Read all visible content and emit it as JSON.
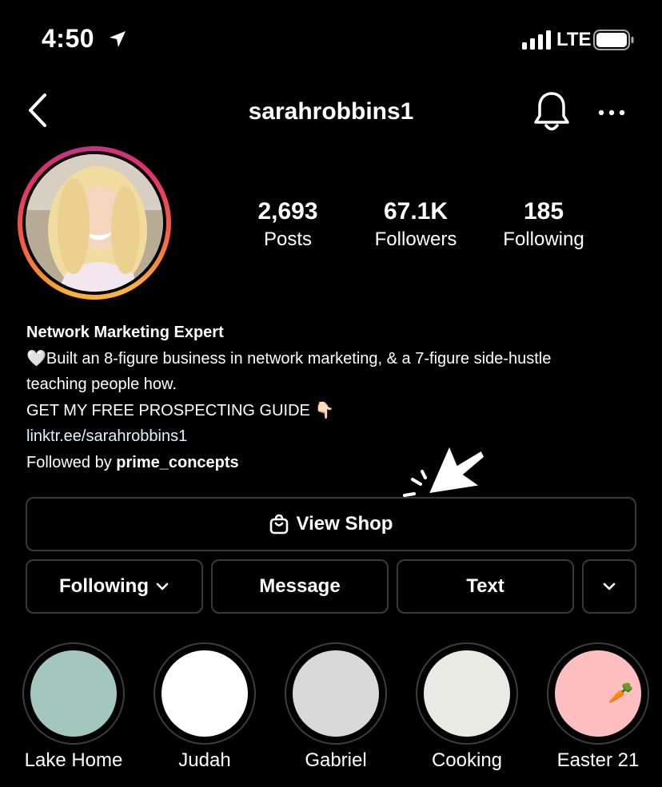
{
  "status_bar": {
    "time": "4:50",
    "network": "LTE"
  },
  "header": {
    "username": "sarahrobbins1"
  },
  "stats": [
    {
      "value": "2,693",
      "label": "Posts"
    },
    {
      "value": "67.1K",
      "label": "Followers"
    },
    {
      "value": "185",
      "label": "Following"
    }
  ],
  "bio": {
    "name": "Network Marketing Expert",
    "line1": "🤍Built an 8-figure business in network marketing, & a 7-figure side-hustle",
    "line2": "teaching people how.",
    "line3": "GET MY FREE PROSPECTING GUIDE 👇🏻",
    "link": "linktr.ee/sarahrobbins1",
    "followed_by_prefix": "Followed by ",
    "followed_by_user": "prime_concepts"
  },
  "buttons": {
    "view_shop": "View Shop",
    "following": "Following",
    "message": "Message",
    "text": "Text"
  },
  "highlights": [
    {
      "label": "Lake Home",
      "color": "#a3c6bd",
      "emoji": ""
    },
    {
      "label": "Judah",
      "color": "#ffffff",
      "emoji": ""
    },
    {
      "label": "Gabriel",
      "color": "#d9d9d9",
      "emoji": ""
    },
    {
      "label": "Cooking",
      "color": "#eaeae5",
      "emoji": ""
    },
    {
      "label": "Easter 21",
      "color": "#ffbfbf",
      "emoji": "🥕"
    }
  ],
  "icons": {
    "back": "chevron-left-icon",
    "bell": "bell-icon",
    "more": "more-horizontal-icon",
    "shop": "shopping-bag-icon",
    "dropdown": "chevron-down-icon"
  }
}
